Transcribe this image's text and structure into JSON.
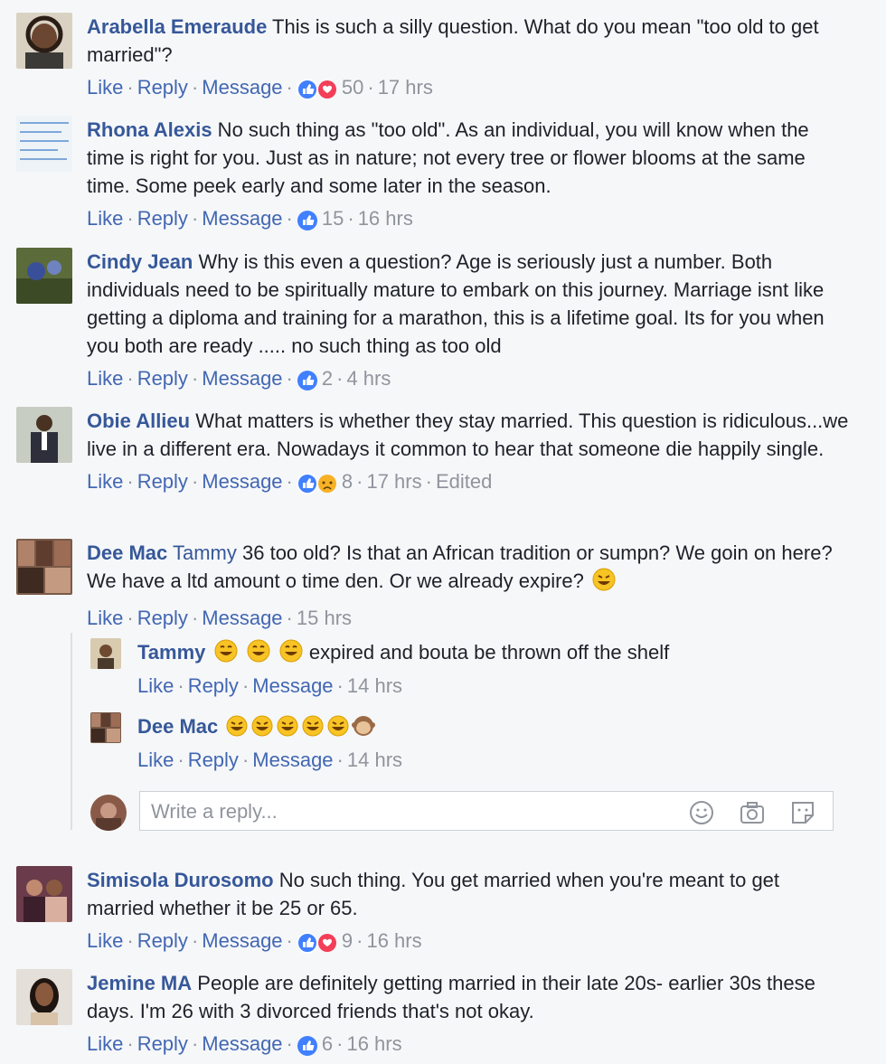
{
  "comments": [
    {
      "name": "Arabella Emeraude",
      "text": " This is such a silly question. What do you mean \"too old to get married\"?",
      "count": "50",
      "time": "17 hrs",
      "edited": ""
    },
    {
      "name": "Rhona Alexis",
      "text": " No such thing as \"too old\". As an individual, you will know when the time is right for you. Just as in nature; not every tree or flower blooms at the same time. Some peek early and some later in the season.",
      "count": "15",
      "time": "16 hrs",
      "edited": ""
    },
    {
      "name": "Cindy Jean",
      "text": " Why is this even a question? Age is seriously just a number. Both individuals need to be spiritually mature to embark on this journey. Marriage isnt like getting a diploma and training for a marathon, this is a lifetime goal. Its for you when you both are ready ..... no such thing as too old",
      "count": "2",
      "time": "4 hrs",
      "edited": ""
    },
    {
      "name": "Obie Allieu",
      "text": " What matters is whether they stay married. This question is ridiculous...we live in a different era. Nowadays it common to hear that someone die happily single.",
      "count": "8",
      "time": "17 hrs",
      "edited": "Edited"
    },
    {
      "name": "Dee Mac",
      "mention": " Tammy",
      "text": " 36 too old? Is that an African tradition or sumpn? We goin on here? We have a ltd amount o time den. Or we already expire?",
      "count": "",
      "time": "15 hrs",
      "edited": ""
    },
    {
      "name": "Simisola Durosomo",
      "text": " No such thing. You get married when you're meant to get married whether it be 25 or 65.",
      "count": "9",
      "time": "16 hrs",
      "edited": ""
    },
    {
      "name": "Jemine MA",
      "text": " People are definitely getting married in their late 20s- earlier 30s these days. I'm 26 with 3 divorced friends that's not okay.",
      "count": "6",
      "time": "16 hrs",
      "edited": ""
    }
  ],
  "replies": [
    {
      "name": "Tammy",
      "text": " expired and bouta be thrown off the shelf",
      "time": "14 hrs"
    },
    {
      "name": "Dee Mac",
      "text": "",
      "time": "14 hrs"
    }
  ],
  "actions": {
    "like": "Like",
    "reply": "Reply",
    "message": "Message",
    "dot": "·"
  },
  "write_reply": {
    "placeholder": "Write a reply..."
  },
  "colors": {
    "name": "#365899",
    "link": "#4267b2",
    "meta": "#90949c",
    "like_blue": "#4080ff",
    "love_red": "#f33e58",
    "haha_yellow": "#f7b125"
  },
  "icons": [
    "like-icon",
    "love-icon",
    "haha-icon",
    "sad-icon",
    "rofl-emoji",
    "laughing-emoji",
    "monkey-emoji",
    "smiley-icon",
    "camera-icon",
    "sticker-icon"
  ]
}
